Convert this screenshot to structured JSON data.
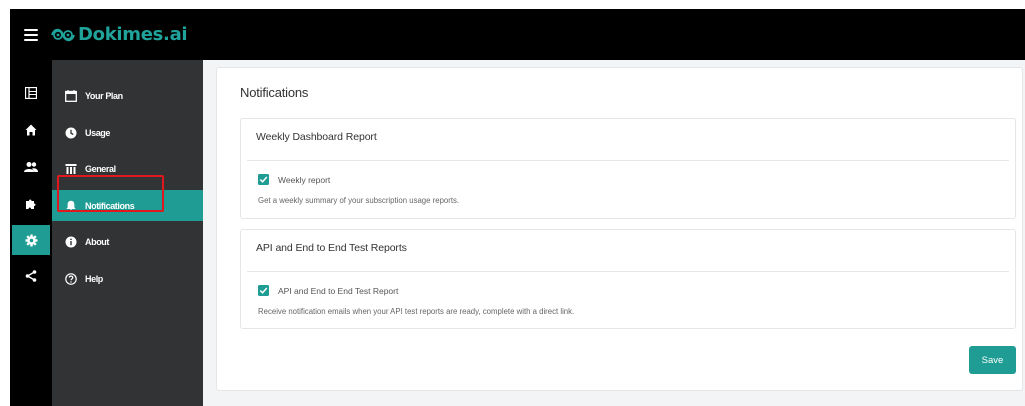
{
  "app": {
    "logo_text": "Dokimes.ai"
  },
  "sidebar": {
    "items": [
      {
        "label": "Your Plan",
        "icon": "calendar-icon"
      },
      {
        "label": "Usage",
        "icon": "clock-icon"
      },
      {
        "label": "General",
        "icon": "settings-sliders-icon"
      },
      {
        "label": "Notifications",
        "icon": "bell-icon",
        "active": true
      },
      {
        "label": "About",
        "icon": "info-icon"
      },
      {
        "label": "Help",
        "icon": "help-icon"
      }
    ]
  },
  "icon_rail": [
    "dashboard-icon",
    "home-icon",
    "users-icon",
    "puzzle-icon",
    "settings-icon",
    "share-icon"
  ],
  "page": {
    "title": "Notifications",
    "sections": [
      {
        "title": "Weekly Dashboard Report",
        "checkbox_label": "Weekly report",
        "checked": true,
        "description": "Get a weekly summary of your subscription usage reports."
      },
      {
        "title": "API and End to End Test Reports",
        "checkbox_label": "API and End to End Test Report",
        "checked": true,
        "description": "Receive notification emails when your API test reports are ready, complete with a direct link."
      }
    ],
    "save_label": "Save"
  },
  "colors": {
    "accent": "#1f9c93",
    "highlight": "#e0181d",
    "sidebar_bg": "#313335",
    "topbar_bg": "#000000"
  }
}
